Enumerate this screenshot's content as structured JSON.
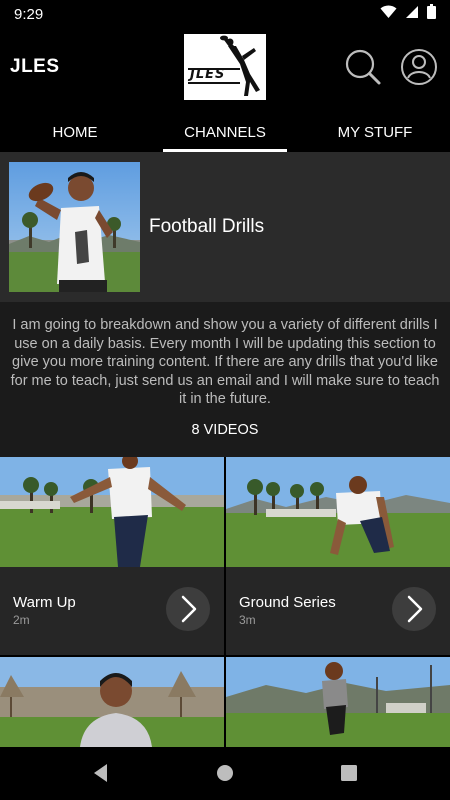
{
  "status": {
    "time": "9:29"
  },
  "header": {
    "title": "JLES",
    "logo_text": "JLES"
  },
  "tabs": [
    {
      "label": "HOME"
    },
    {
      "label": "CHANNELS"
    },
    {
      "label": "MY STUFF"
    }
  ],
  "channel": {
    "title": "Football Drills",
    "description": "I am going to breakdown and show you a variety of different drills I use on a daily basis. Every month I will be updating this section to give you more training content. If there are any drills that you'd like for me to teach, just send us an email and I will make sure to teach it in the future.",
    "video_count": "8 VIDEOS"
  },
  "videos": [
    {
      "title": "Warm Up",
      "duration": "2m"
    },
    {
      "title": "Ground Series",
      "duration": "3m"
    }
  ],
  "icons": [
    "wifi-icon",
    "signal-icon",
    "battery-icon",
    "search-icon",
    "account-icon",
    "chevron-right-icon",
    "back-icon",
    "home-icon",
    "recents-icon"
  ]
}
